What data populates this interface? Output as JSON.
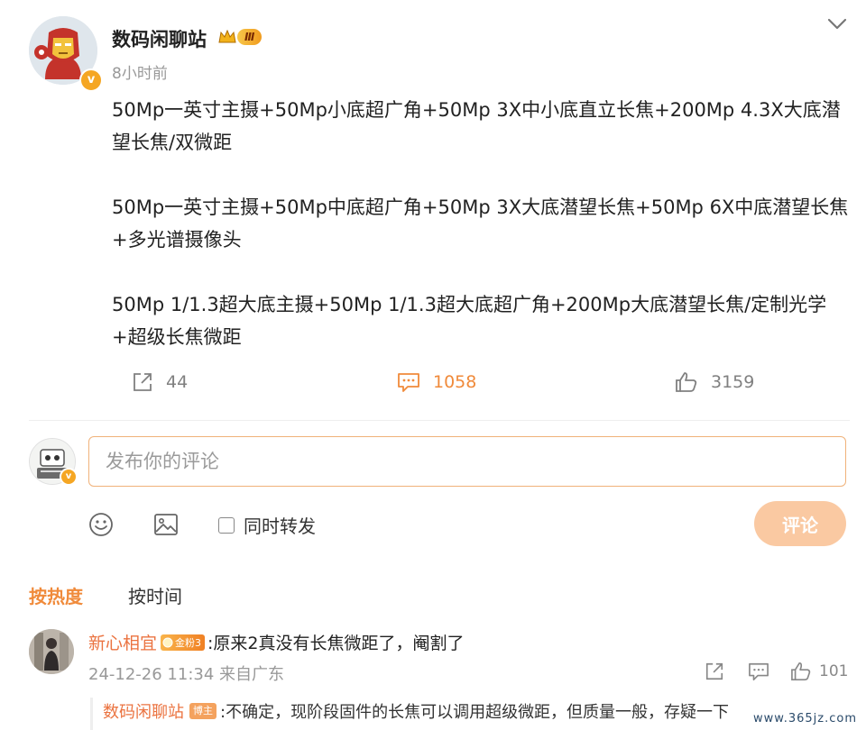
{
  "post": {
    "author_name": "数码闲聊站",
    "vip_level": "Ⅲ",
    "verified_mark": "v",
    "time": "8小时前",
    "paragraphs": [
      "50Mp一英寸主摄+50Mp小底超广角+50Mp 3X中小底直立长焦+200Mp 4.3X大底潜望长焦/双微距",
      "50Mp一英寸主摄+50Mp中底超广角+50Mp 3X大底潜望长焦+50Mp 6X中底潜望长焦+多光谱摄像头",
      "50Mp 1/1.3超大底主摄+50Mp 1/1.3超大底超广角+200Mp大底潜望长焦/定制光学+超级长焦微距"
    ],
    "actions": {
      "repost_count": "44",
      "comment_count": "1058",
      "like_count": "3159"
    }
  },
  "composer": {
    "placeholder": "发布你的评论",
    "repost_label": "同时转发",
    "submit_label": "评论",
    "verified_mark": "v"
  },
  "sort_tabs": {
    "hot": "按热度",
    "time": "按时间"
  },
  "comment": {
    "name": "新心相宜",
    "fan_badge": "金粉3",
    "text": ":原来2真没有长焦微距了，阉割了",
    "meta": "24-12-26 11:34 来自广东",
    "like_count": "101"
  },
  "reply": {
    "name": "数码闲聊站",
    "badge": "博主",
    "text": ":不确定，现阶段固件的长焦可以调用超级微距，但质量一般，存疑一下"
  },
  "watermark": "www.365jz.com",
  "colors": {
    "accent": "#f08a3a",
    "name_link": "#eb7340",
    "input_border": "#f0b27a",
    "submit_disabled": "#fac9a2",
    "muted": "#999999"
  },
  "icons": {
    "repost": "share-box-icon",
    "comment": "comment-bubble-icon",
    "like": "thumbs-up-icon",
    "emoji": "smiley-icon",
    "image": "picture-icon",
    "menu": "chevron-down-icon"
  }
}
